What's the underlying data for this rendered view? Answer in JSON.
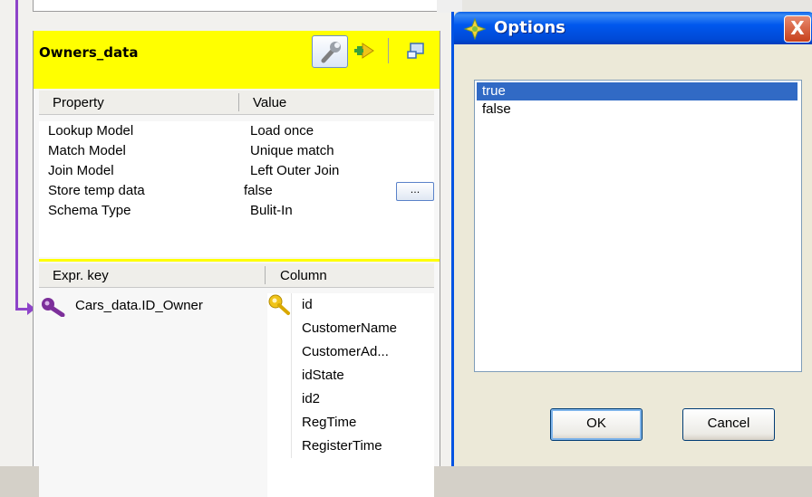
{
  "table": {
    "title": "Owners_data",
    "property_grid": {
      "headers": [
        "Property",
        "Value"
      ],
      "rows": [
        {
          "property": "Lookup Model",
          "value": "Load once"
        },
        {
          "property": "Match Model",
          "value": "Unique match"
        },
        {
          "property": "Join Model",
          "value": "Left Outer Join"
        },
        {
          "property": "Store temp data",
          "value": "false"
        },
        {
          "property": "Schema Type",
          "value": "Bulit-In"
        }
      ],
      "ellipsis_label": "..."
    },
    "expr_grid": {
      "headers": [
        "Expr. key",
        "Column"
      ],
      "expr_key": "Cars_data.ID_Owner",
      "columns": [
        "id",
        "CustomerName",
        "CustomerAd...",
        "idState",
        "id2",
        "RegTime",
        "RegisterTime"
      ]
    },
    "toolbar_icons": [
      "wrench-icon",
      "import-arrow-icon",
      "window-icon"
    ]
  },
  "dialog": {
    "title": "Options",
    "close_label": "X",
    "options": [
      "true",
      "false"
    ],
    "selected": "true",
    "ok_label": "OK",
    "cancel_label": "Cancel"
  },
  "colors": {
    "header_yellow": "#ffff00",
    "link_purple": "#8e44c9",
    "selection_blue": "#316ac5",
    "titlebar_blue": "#0058ee"
  }
}
